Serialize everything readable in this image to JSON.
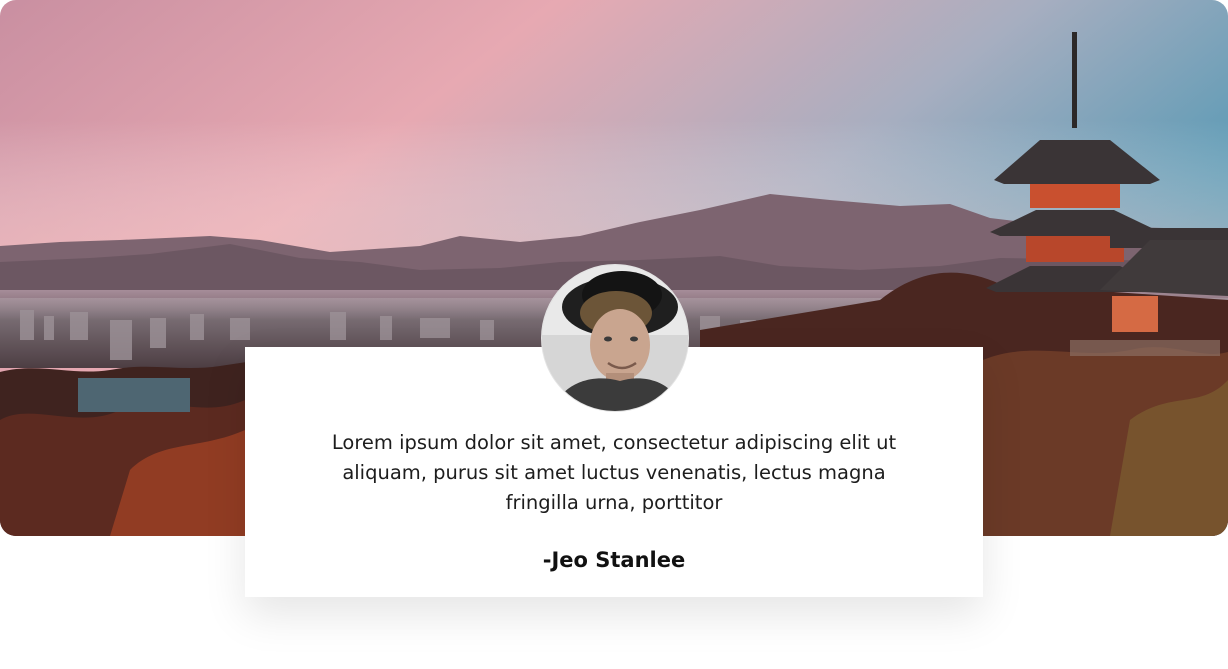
{
  "testimonial": {
    "quote": "Lorem ipsum dolor sit amet, consectetur adipiscing elit ut aliquam, purus sit amet luctus venenatis, lectus magna fringilla urna, porttitor",
    "author": "-Jeo Stanlee"
  },
  "colors": {
    "sky_top": "#5d97b0",
    "sky_pink": "#e9a8b4",
    "mountain": "#6e5560",
    "foliage": "#5a2d22",
    "pagoda": "#c9502f",
    "card": "#ffffff"
  },
  "icons": {
    "avatar": "person-avatar"
  }
}
